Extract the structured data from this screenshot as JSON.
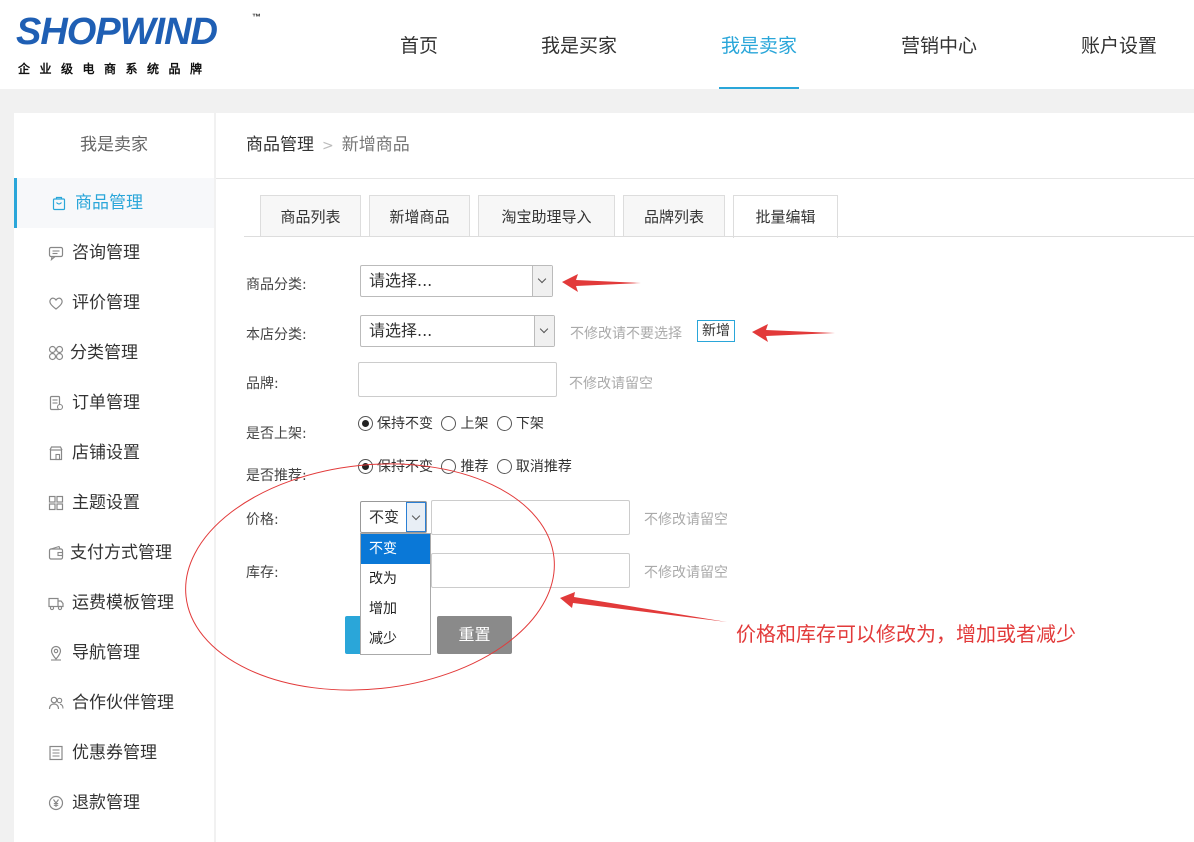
{
  "logo": {
    "word": "SHOPWIND",
    "tm": "™",
    "tagline": "企业级电商系统品牌"
  },
  "nav": [
    {
      "label": "首页",
      "active": false
    },
    {
      "label": "我是买家",
      "active": false
    },
    {
      "label": "我是卖家",
      "active": true
    },
    {
      "label": "营销中心",
      "active": false
    },
    {
      "label": "账户设置",
      "active": false
    }
  ],
  "sidebar": {
    "title": "我是卖家",
    "items": [
      {
        "label": "商品管理",
        "icon": "bag-icon",
        "active": true
      },
      {
        "label": "咨询管理",
        "icon": "chat-icon"
      },
      {
        "label": "评价管理",
        "icon": "heart-icon"
      },
      {
        "label": "分类管理",
        "icon": "grid-circles-icon"
      },
      {
        "label": "订单管理",
        "icon": "order-icon"
      },
      {
        "label": "店铺设置",
        "icon": "shop-icon"
      },
      {
        "label": "主题设置",
        "icon": "theme-grid-icon"
      },
      {
        "label": "支付方式管理",
        "icon": "wallet-icon"
      },
      {
        "label": "运费模板管理",
        "icon": "truck-icon"
      },
      {
        "label": "导航管理",
        "icon": "location-icon"
      },
      {
        "label": "合作伙伴管理",
        "icon": "people-icon"
      },
      {
        "label": "优惠券管理",
        "icon": "coupon-icon"
      },
      {
        "label": "退款管理",
        "icon": "yen-icon"
      }
    ]
  },
  "breadcrumb": {
    "parent": "商品管理",
    "current": "新增商品",
    "sep": ">"
  },
  "tabs": [
    {
      "label": "商品列表"
    },
    {
      "label": "新增商品"
    },
    {
      "label": "淘宝助理导入"
    },
    {
      "label": "品牌列表"
    },
    {
      "label": "批量编辑",
      "active": true
    }
  ],
  "form": {
    "category": {
      "label": "商品分类:",
      "value": "请选择..."
    },
    "store_category": {
      "label": "本店分类:",
      "value": "请选择...",
      "hint": "不修改请不要选择",
      "add_label": "新增"
    },
    "brand": {
      "label": "品牌:",
      "value": "",
      "hint": "不修改请留空"
    },
    "on_shelf": {
      "label": "是否上架:",
      "options": [
        "保持不变",
        "上架",
        "下架"
      ],
      "selected": 0
    },
    "recommend": {
      "label": "是否推荐:",
      "options": [
        "保持不变",
        "推荐",
        "取消推荐"
      ],
      "selected": 0
    },
    "price": {
      "label": "价格:",
      "op_value": "不变",
      "hint": "不修改请留空"
    },
    "stock": {
      "label": "库存:",
      "hint": "不修改请留空"
    },
    "dropdown_options": [
      "不变",
      "改为",
      "增加",
      "减少"
    ],
    "dropdown_selected": 0,
    "reset_label": "重置"
  },
  "annotation": {
    "text": "价格和库存可以修改为，增加或者减少",
    "color": "#e23a3a"
  },
  "colors": {
    "accent": "#2aa6d9",
    "logo": "#1f5fb4",
    "reset": "#8a8a8a"
  }
}
